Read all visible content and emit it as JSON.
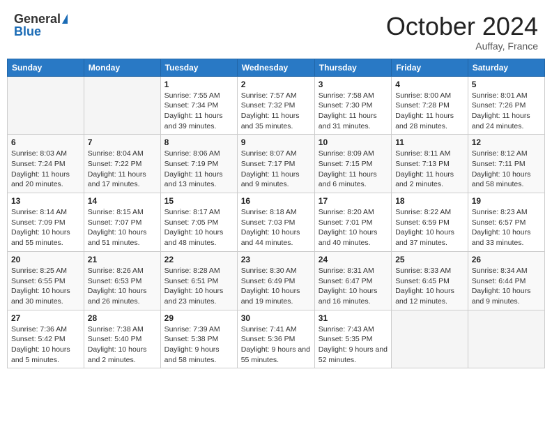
{
  "header": {
    "logo_general": "General",
    "logo_blue": "Blue",
    "month_title": "October 2024",
    "location": "Auffay, France"
  },
  "days_of_week": [
    "Sunday",
    "Monday",
    "Tuesday",
    "Wednesday",
    "Thursday",
    "Friday",
    "Saturday"
  ],
  "weeks": [
    [
      {
        "day": "",
        "empty": true
      },
      {
        "day": "",
        "empty": true
      },
      {
        "day": "1",
        "sunrise": "Sunrise: 7:55 AM",
        "sunset": "Sunset: 7:34 PM",
        "daylight": "Daylight: 11 hours and 39 minutes."
      },
      {
        "day": "2",
        "sunrise": "Sunrise: 7:57 AM",
        "sunset": "Sunset: 7:32 PM",
        "daylight": "Daylight: 11 hours and 35 minutes."
      },
      {
        "day": "3",
        "sunrise": "Sunrise: 7:58 AM",
        "sunset": "Sunset: 7:30 PM",
        "daylight": "Daylight: 11 hours and 31 minutes."
      },
      {
        "day": "4",
        "sunrise": "Sunrise: 8:00 AM",
        "sunset": "Sunset: 7:28 PM",
        "daylight": "Daylight: 11 hours and 28 minutes."
      },
      {
        "day": "5",
        "sunrise": "Sunrise: 8:01 AM",
        "sunset": "Sunset: 7:26 PM",
        "daylight": "Daylight: 11 hours and 24 minutes."
      }
    ],
    [
      {
        "day": "6",
        "sunrise": "Sunrise: 8:03 AM",
        "sunset": "Sunset: 7:24 PM",
        "daylight": "Daylight: 11 hours and 20 minutes."
      },
      {
        "day": "7",
        "sunrise": "Sunrise: 8:04 AM",
        "sunset": "Sunset: 7:22 PM",
        "daylight": "Daylight: 11 hours and 17 minutes."
      },
      {
        "day": "8",
        "sunrise": "Sunrise: 8:06 AM",
        "sunset": "Sunset: 7:19 PM",
        "daylight": "Daylight: 11 hours and 13 minutes."
      },
      {
        "day": "9",
        "sunrise": "Sunrise: 8:07 AM",
        "sunset": "Sunset: 7:17 PM",
        "daylight": "Daylight: 11 hours and 9 minutes."
      },
      {
        "day": "10",
        "sunrise": "Sunrise: 8:09 AM",
        "sunset": "Sunset: 7:15 PM",
        "daylight": "Daylight: 11 hours and 6 minutes."
      },
      {
        "day": "11",
        "sunrise": "Sunrise: 8:11 AM",
        "sunset": "Sunset: 7:13 PM",
        "daylight": "Daylight: 11 hours and 2 minutes."
      },
      {
        "day": "12",
        "sunrise": "Sunrise: 8:12 AM",
        "sunset": "Sunset: 7:11 PM",
        "daylight": "Daylight: 10 hours and 58 minutes."
      }
    ],
    [
      {
        "day": "13",
        "sunrise": "Sunrise: 8:14 AM",
        "sunset": "Sunset: 7:09 PM",
        "daylight": "Daylight: 10 hours and 55 minutes."
      },
      {
        "day": "14",
        "sunrise": "Sunrise: 8:15 AM",
        "sunset": "Sunset: 7:07 PM",
        "daylight": "Daylight: 10 hours and 51 minutes."
      },
      {
        "day": "15",
        "sunrise": "Sunrise: 8:17 AM",
        "sunset": "Sunset: 7:05 PM",
        "daylight": "Daylight: 10 hours and 48 minutes."
      },
      {
        "day": "16",
        "sunrise": "Sunrise: 8:18 AM",
        "sunset": "Sunset: 7:03 PM",
        "daylight": "Daylight: 10 hours and 44 minutes."
      },
      {
        "day": "17",
        "sunrise": "Sunrise: 8:20 AM",
        "sunset": "Sunset: 7:01 PM",
        "daylight": "Daylight: 10 hours and 40 minutes."
      },
      {
        "day": "18",
        "sunrise": "Sunrise: 8:22 AM",
        "sunset": "Sunset: 6:59 PM",
        "daylight": "Daylight: 10 hours and 37 minutes."
      },
      {
        "day": "19",
        "sunrise": "Sunrise: 8:23 AM",
        "sunset": "Sunset: 6:57 PM",
        "daylight": "Daylight: 10 hours and 33 minutes."
      }
    ],
    [
      {
        "day": "20",
        "sunrise": "Sunrise: 8:25 AM",
        "sunset": "Sunset: 6:55 PM",
        "daylight": "Daylight: 10 hours and 30 minutes."
      },
      {
        "day": "21",
        "sunrise": "Sunrise: 8:26 AM",
        "sunset": "Sunset: 6:53 PM",
        "daylight": "Daylight: 10 hours and 26 minutes."
      },
      {
        "day": "22",
        "sunrise": "Sunrise: 8:28 AM",
        "sunset": "Sunset: 6:51 PM",
        "daylight": "Daylight: 10 hours and 23 minutes."
      },
      {
        "day": "23",
        "sunrise": "Sunrise: 8:30 AM",
        "sunset": "Sunset: 6:49 PM",
        "daylight": "Daylight: 10 hours and 19 minutes."
      },
      {
        "day": "24",
        "sunrise": "Sunrise: 8:31 AM",
        "sunset": "Sunset: 6:47 PM",
        "daylight": "Daylight: 10 hours and 16 minutes."
      },
      {
        "day": "25",
        "sunrise": "Sunrise: 8:33 AM",
        "sunset": "Sunset: 6:45 PM",
        "daylight": "Daylight: 10 hours and 12 minutes."
      },
      {
        "day": "26",
        "sunrise": "Sunrise: 8:34 AM",
        "sunset": "Sunset: 6:44 PM",
        "daylight": "Daylight: 10 hours and 9 minutes."
      }
    ],
    [
      {
        "day": "27",
        "sunrise": "Sunrise: 7:36 AM",
        "sunset": "Sunset: 5:42 PM",
        "daylight": "Daylight: 10 hours and 5 minutes."
      },
      {
        "day": "28",
        "sunrise": "Sunrise: 7:38 AM",
        "sunset": "Sunset: 5:40 PM",
        "daylight": "Daylight: 10 hours and 2 minutes."
      },
      {
        "day": "29",
        "sunrise": "Sunrise: 7:39 AM",
        "sunset": "Sunset: 5:38 PM",
        "daylight": "Daylight: 9 hours and 58 minutes."
      },
      {
        "day": "30",
        "sunrise": "Sunrise: 7:41 AM",
        "sunset": "Sunset: 5:36 PM",
        "daylight": "Daylight: 9 hours and 55 minutes."
      },
      {
        "day": "31",
        "sunrise": "Sunrise: 7:43 AM",
        "sunset": "Sunset: 5:35 PM",
        "daylight": "Daylight: 9 hours and 52 minutes."
      },
      {
        "day": "",
        "empty": true
      },
      {
        "day": "",
        "empty": true
      }
    ]
  ]
}
